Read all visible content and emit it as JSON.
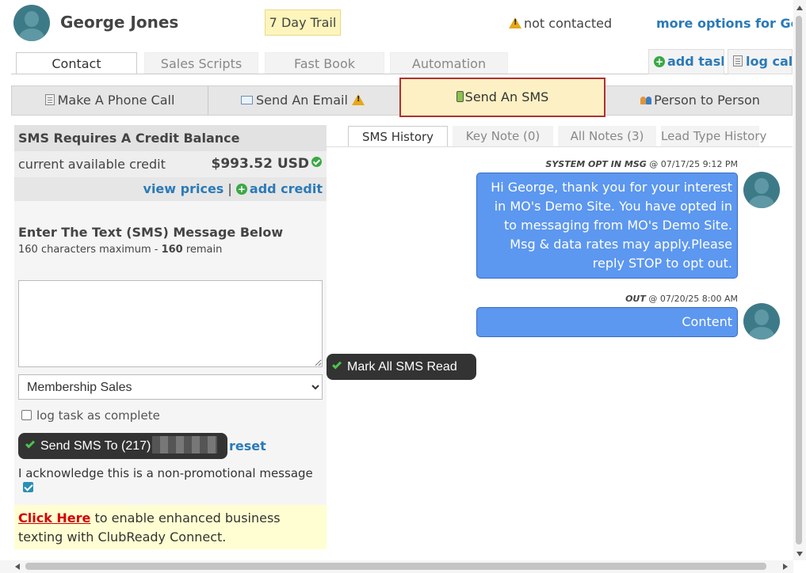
{
  "header": {
    "contact_name": "George Jones",
    "trial_badge": "7 Day Trail",
    "contact_status": "not contacted",
    "more_options": "more options for George"
  },
  "top_tabs": [
    "Contact",
    "Sales Scripts",
    "Fast Book",
    "Automation"
  ],
  "top_links": {
    "add_task": "add task",
    "log_call": "log call"
  },
  "actions": {
    "phone_call": "Make A Phone Call",
    "email": "Send An Email",
    "sms": "Send An SMS",
    "person": "Person to Person"
  },
  "credit": {
    "title": "SMS Requires A Credit Balance",
    "label": "current available credit",
    "amount": "$993.52 USD",
    "view_prices": "view prices",
    "separator": "|",
    "add_credit": "add credit"
  },
  "compose": {
    "title": "Enter The Text (SMS) Message Below",
    "hint_prefix": "160 characters maximum - ",
    "hint_count": "160",
    "hint_suffix": " remain",
    "message_value": "",
    "template_selected": "Membership Sales",
    "log_task_label": "log task as complete",
    "send_button_prefix": "Send SMS To (217)",
    "reset": "reset",
    "acknowledge": "I acknowledge this is a non-promotional message",
    "acknowledge_checked": true
  },
  "promo": {
    "link": "Click Here",
    "text": " to enable enhanced business texting with ClubReady Connect."
  },
  "right_tabs": [
    "SMS History",
    "Key Note (0)",
    "All Notes (3)",
    "Lead Type History"
  ],
  "messages": [
    {
      "type": "SYSTEM OPT IN MSG",
      "timestamp": "@ 07/17/25 9:12 PM",
      "text": "Hi George, thank you for your interest in MO's Demo Site. You have opted in to messaging from MO's Demo Site. Msg & data rates may apply.Please reply STOP to opt out."
    },
    {
      "type": "OUT",
      "timestamp": "@ 07/20/25 8:00 AM",
      "text": "Content"
    }
  ],
  "mark_all_read": "Mark All SMS Read",
  "colors": {
    "link": "#2a7ab8",
    "bubble": "#5c97f0",
    "selected_action_bg": "#fdf0c4",
    "selected_action_border": "#b03030",
    "dark_button": "#333333",
    "promo_link": "#d40000"
  },
  "icons": {
    "phone_call": "notepad-icon",
    "email": "envelope-icon",
    "email_warning": "warning-icon",
    "sms": "mobile-phone-icon",
    "person": "people-icon",
    "credit_ok": "green-check-circle-icon",
    "add": "green-plus-icon"
  }
}
